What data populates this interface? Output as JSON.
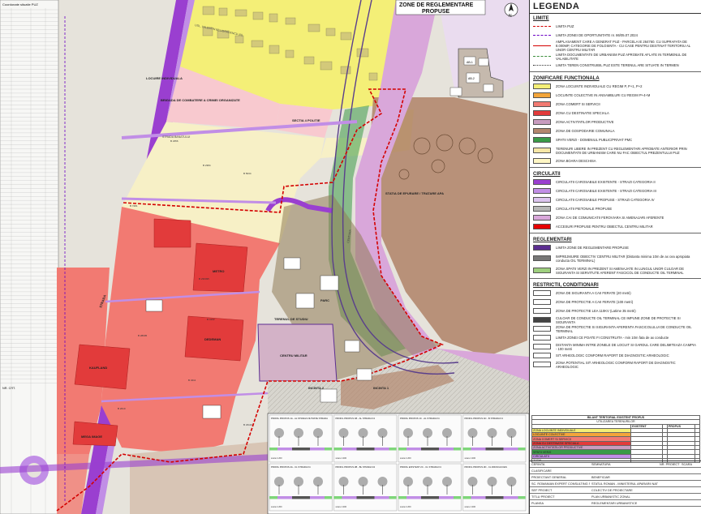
{
  "map": {
    "title_line1": "ZONE DE REGLEMENTARE",
    "title_line2": "PROPUSE",
    "north_label": "N",
    "coord_table_title": "Coordonate situatie PUZ",
    "coord_table_title_2": "NR. CRT.",
    "zone_labels": {
      "lh_upper": "LOCUIRE INDIVIDUALA",
      "lh_center": "BRIGADA DE COMBATERE A CRIMEI ORGANIZATE",
      "lh_right": "SECTIA 4 POLITIE",
      "ua_top": "USL. VALENTIN BELIGRADENCU (N)",
      "ue_label": "STRADA BANATULUI",
      "circ_label": "CENTURA",
      "station": "STATIA DE EPURARE / TRATARE APA",
      "metro": "METRO",
      "dedeman": "DEDEMAN",
      "kaufland": "KAUFLAND",
      "mega": "MEGA IMAGE",
      "stradal": "STRADA",
      "central_block": "TERENUL DE STUDIU",
      "militar": "CENTRU MILITAR",
      "parc": "PARC",
      "tram": "STRADA",
      "incinta_1": "INCINTA 1",
      "incinta_2": "INCINTA 2",
      "ab_label": "AB-1",
      "ab_label2": "AB-2"
    },
    "area_labels": [
      "B 2384",
      "B 5034",
      "B 7281",
      "B 2356",
      "B 230495",
      "B 4102",
      "B 2010",
      "B 23110",
      "B 3411",
      "B 28005"
    ],
    "profiles": [
      "PROFIL PROPUS 1A - AL STRADA FILTRATE STRADA",
      "PROFIL PROPUS 1B - AL STRADA F4",
      "PROFIL PROPUS 1C - AL STRADA F4",
      "PROFIL PROPUS 1D - B STRADA F4",
      "PROFIL PROPUS 2A - CL STRADA F4",
      "PROFIL PROPUS 2B - BL STRADA F4",
      "PROFIL EXISTENT 2C - CL STRADA F4",
      "PROFIL PROPUS 2D - CL DRUM ACCES"
    ],
    "profile_scale": "scara 1:200"
  },
  "legend": {
    "title": "LEGENDA",
    "limits_title": "LIMITE",
    "limits": [
      {
        "label": "LIMITA PUZ",
        "color": "#d40000",
        "style": "dash"
      },
      {
        "label": "LIMITA ZONEI DE OPORTUNITATE nr. 86/05.07.2024",
        "color": "#6a00c4",
        "style": "dash"
      },
      {
        "label": "AMPLASAMENT CARE A GENERAT PUZ - PARCELA IE 264760. CU SUPRAFATA DE 8.000MP, CATEGORIE DE FOLOSINTA - CU CASE PENTRU DESTINAT TERITORIU AL UNOR CENTRU MILITAR",
        "color": "#d40000",
        "style": "solid"
      },
      {
        "label": "LIMITA DOCUMENTATII DE URBANISM PUZ APROBATE AFLATE IN TERMENUL DE VALABILITATE",
        "color": "#3c8f3c",
        "style": "dash"
      },
      {
        "label": "LIMITA TEREN CONSTRUIBIL PUZ ESTE TERENUL ARE SITUATE IN TERMEN",
        "color": "#333333",
        "style": "dot"
      }
    ],
    "zoning_title": "ZONIFICARE FUNCTIONALA",
    "zoning": [
      {
        "label": "ZONA LOCUINTE INDIVIDUALE CU REGIM P, P+1, P+2",
        "color": "#f4ef77"
      },
      {
        "label": "LOCUINTE COLECTIVE IN ANSAMBLURI CU REGIM P+4+M",
        "color": "#f3a53a"
      },
      {
        "label": "ZONA COMERT SI SERVICII",
        "color": "#f27a72"
      },
      {
        "label": "ZONA CU DESTINATIE SPECIALA",
        "color": "#e23b3b"
      },
      {
        "label": "ZONA ACTIVITATILOR PRODUCTIVE",
        "color": "#c89cc0"
      },
      {
        "label": "ZONA DE GOSPODARIE COMUNALA",
        "color": "#b3876e"
      },
      {
        "label": "SPATII VERZI - DOMENIUL PUBLIC/PRIVAT PMC",
        "color": "#3a9b47"
      },
      {
        "label": "TERENURI LIBERE IN PREZENT CU REGLEMENTARI APROBATE ANTERIOR PRIN DOCUMENTATII DE URBANISM CARE NU FAC OBIECTUL PREZENTULUI PUZ",
        "color": "#f7e7a6"
      },
      {
        "label": "ZONA BOARA DESCHISA",
        "color": "#fff7c4"
      }
    ],
    "circulation_title": "CIRCULATII",
    "circulation": [
      {
        "label": "CIRCULATII CAROSABILE EXISTENTE - STRAZI CATEGORIA II",
        "color": "#9a3fd0"
      },
      {
        "label": "CIRCULATII CAROSABILE EXISTENTE - STRAZI CATEGORIA III",
        "color": "#c18ee6"
      },
      {
        "label": "CIRCULATII CAROSABILE PROPUSE - STRAZI CATEGORIA IV",
        "color": "#dcc4ef"
      },
      {
        "label": "CIRCULATII PIETONALE PROPUSE",
        "color": "#b7b7b7"
      },
      {
        "label": "ZONA CAI DE COMUNICATII FEROVIARA SI AMENAJARI AFERENTE",
        "color": "#d9a7da"
      },
      {
        "label": "ACCESURI PROPUSE PENTRU OBIECTUL CENTRU MILITAR",
        "color": "#e60000"
      }
    ],
    "regulations_title": "REGLEMENTARI",
    "regulations": [
      {
        "label": "LIMITA ZONE DE REGLEMENTARE PROPUSE",
        "color": "#5c2e91"
      },
      {
        "label": "IMPREJMUIRE OBIECTIV CENTRU MILITAR (Distanta minima 10m de ax cea apropiata conducta OIL TERMINAL)",
        "color": "#777777"
      },
      {
        "label": "ZONA SPATII VERZI IN PREZENT SI AMENAJATE IN LUNGUL UNOR CULOAR DE SIGURANTA SI SERVITUTE AFERENT FASCICOL DE CONDUCTE OIL TERMINAL",
        "color": "#9ecf7e"
      }
    ],
    "restrictions_title": "RESTRICTII, CONDITIONARI",
    "restrictions": [
      {
        "label": "ZONA DE SIGURANTA A CAII FERATE (20 metri)",
        "color": "#ffffff"
      },
      {
        "label": "ZONA DE PROTECTIE A CAII FERATE (100 metri)",
        "color": "#ffffff"
      },
      {
        "label": "ZONA DE PROTECTIE LEA 110KV (Latime 35 metri)",
        "color": "#ffffff"
      },
      {
        "label": "CULOAR DE CONDUCTE OIL TERMINAL CE IMPUNE ZONE DE PROTECTIE SI SIGURANTA",
        "color": "#444444"
      },
      {
        "label": "ZONA DE PROTECTIE SI SIGURANTA AFERENTA FASCICOLULUI DE CONDUCTE OIL TERMINAL",
        "color": "#ffffff"
      },
      {
        "label": "LIMITA ZONEI CE POATE FI CONSTRUITA - min 10m fata de ax conducte",
        "color": "#ffffff"
      },
      {
        "label": "DISTANTA MINIMA INTRE ZONELE DE LOCUIT SI GARDUL CARE DELIMITEAZA CAMPIA - 100 metri",
        "color": "#ffffff"
      },
      {
        "label": "SIT ARHEOLOGIC CONFORM RAPORT DE DIAGNOSTIC ARHEOLOGIC",
        "color": "#ffffff"
      },
      {
        "label": "ZONA POTENTIAL SIT ARHEOLOGIC CONFORM RAPORT DE DIAGNOSTIC ARHEOLOGIC",
        "color": "#ffffff"
      }
    ],
    "balance_title": "BILANT TERITORIAL EXISTENT PROPUS",
    "balance_sub": "UTILIZAREA TERENURILOR",
    "balance_headers": [
      "",
      "EXISTENT",
      "",
      "PROPUS",
      ""
    ],
    "balance_rows": [
      {
        "label": "ZONA LOCUINTE INDIVIDUALE",
        "color": "#f4ef77"
      },
      {
        "label": "LOCUINTE COLECTIVE",
        "color": "#f3a53a"
      },
      {
        "label": "ZONA COMERT SI SERVICII",
        "color": "#f27a72"
      },
      {
        "label": "ZONA CU DESTINATIE SPECIALA",
        "color": "#e23b3b"
      },
      {
        "label": "ZONA ACTIVITATILOR PRODUCTIVE",
        "color": "#c89cc0"
      },
      {
        "label": "SPATII VERZI",
        "color": "#3a9b47"
      },
      {
        "label": "CIRCULATII",
        "color": "#c18ee6"
      },
      {
        "label": "TOTAL",
        "color": "#ffffff"
      }
    ],
    "cartouche": [
      [
        "CERINTA",
        "SEMNATURA",
        "NR. PROIECT",
        "SCARA"
      ],
      [
        "CLASIFICARE",
        "",
        "",
        ""
      ],
      [
        "PROIECTANT GENERAL",
        "BENEFICIAR",
        "",
        ""
      ],
      [
        "SC. ROMANIAN EXPERT CONSULTING SRL",
        "STATUL ROMAN - MINISTERUL APARARII NATIONALE",
        "",
        ""
      ],
      [
        "SEF PROIECT",
        "COLECTIV DE PROIECTARE",
        "",
        ""
      ],
      [
        "TITLU PROIECT",
        "PLAN URBANISTIC ZONAL",
        "",
        ""
      ],
      [
        "PLANSA",
        "REGLEMENTARI URBANISTICE",
        "",
        ""
      ]
    ]
  },
  "colors": {
    "residential": "#f4ef77",
    "collective": "#f3a53a",
    "commerce": "#f27a72",
    "special": "#e23b3b",
    "productive": "#c89cc0",
    "utility": "#b3876e",
    "green": "#3a9b47",
    "pinkres": "#f8c9cf",
    "cream": "#f7f0c6",
    "road_purple": "#9a3fd0",
    "puz_limit": "#d40000"
  }
}
